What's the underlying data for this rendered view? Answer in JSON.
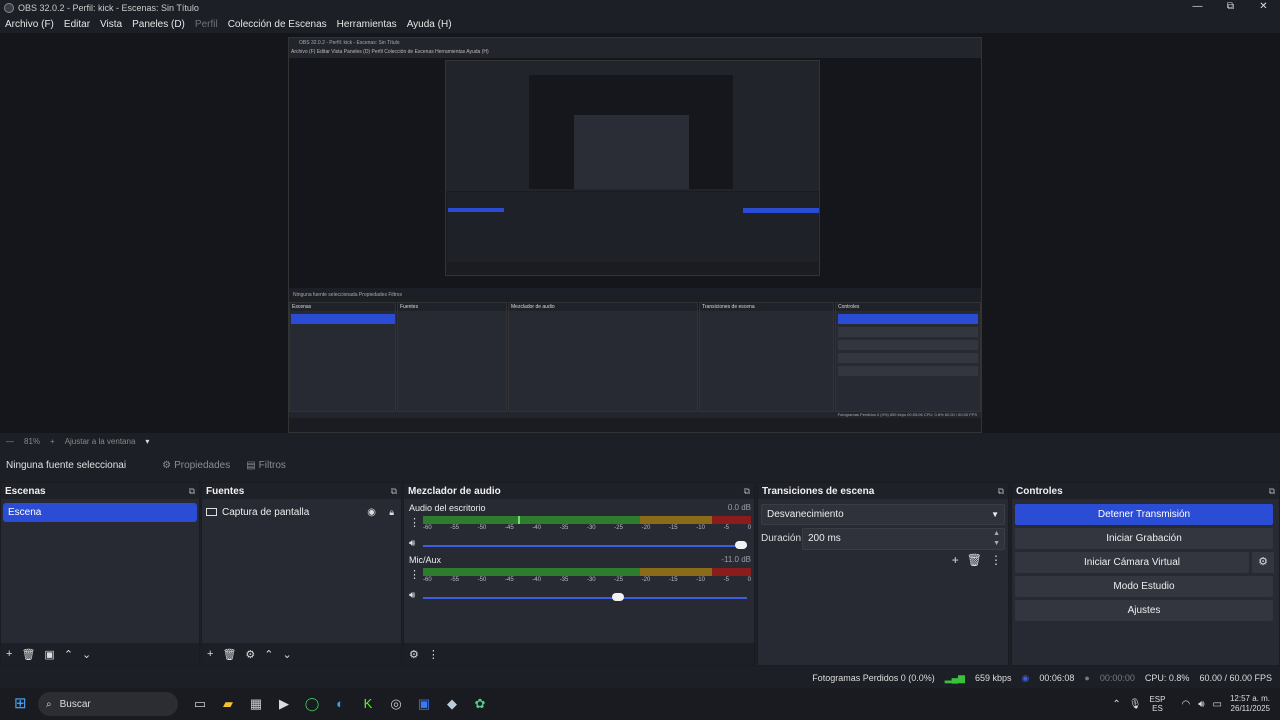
{
  "window": {
    "title": "OBS 32.0.2 - Perfil: kick - Escenas: Sin Título",
    "controls": [
      "—",
      "⧉",
      "✕"
    ]
  },
  "menu": [
    "Archivo (F)",
    "Editar",
    "Vista",
    "Paneles (D)",
    "Perfil",
    "Colección de Escenas",
    "Herramientas",
    "Ayuda (H)"
  ],
  "preview": {
    "nested_title": "OBS 32.0.2 - Perfil: kick - Escenas: Sin Título",
    "nested_menu": "Archivo (F)   Editar   Vista   Paneles (D)   Perfil   Colección de Escenas   Herramientas   Ayuda (H)",
    "nested_source_bar": "Ninguna fuente seleccionada     Propiedades     Filtros",
    "nested_status": "Fotogramas Perdidos 0 (0%)   659 kbps   00:05:06   CPU: 0.8%   60.00 / 60.00 FPS"
  },
  "zoom": {
    "value": "81%",
    "fit_label": "Ajustar a la ventana"
  },
  "source_bar": {
    "none_selected": "Ninguna fuente seleccionai",
    "properties": "Propiedades",
    "filters": "Filtros"
  },
  "scenes": {
    "title": "Escenas",
    "items": [
      "Escena"
    ]
  },
  "sources": {
    "title": "Fuentes",
    "items": [
      "Captura de pantalla"
    ]
  },
  "mixer": {
    "title": "Mezclador de audio",
    "ticks": [
      "-60",
      "-55",
      "-50",
      "-45",
      "-40",
      "-35",
      "-30",
      "-25",
      "-20",
      "-15",
      "-10",
      "-5",
      "0"
    ],
    "channels": [
      {
        "name": "Audio del escritorio",
        "db": "0.0 dB",
        "level": 0.29,
        "volume": 1.0
      },
      {
        "name": "Mic/Aux",
        "db": "-11.0 dB",
        "level": 0.0,
        "volume": 0.62
      }
    ]
  },
  "transitions": {
    "title": "Transiciones de escena",
    "selected": "Desvanecimiento",
    "duration_label": "Duración",
    "duration_value": "200 ms"
  },
  "controls": {
    "title": "Controles",
    "stop_stream": "Detener Transmisión",
    "start_recording": "Iniciar Grabación",
    "start_virtual_cam": "Iniciar Cámara Virtual",
    "studio_mode": "Modo Estudio",
    "settings": "Ajustes"
  },
  "status": {
    "dropped": "Fotogramas Perdidos 0 (0.0%)",
    "bitrate": "659 kbps",
    "stream_time": "00:06:08",
    "rec_time": "00:00:00",
    "cpu": "CPU: 0.8%",
    "fps": "60.00 / 60.00 FPS"
  },
  "taskbar": {
    "search": "Buscar",
    "lang_top": "ESP",
    "lang_bottom": "ES",
    "time": "12:57 a. m.",
    "date": "26/11/2025"
  },
  "colors": {
    "accent": "#2b4dd6",
    "panel": "#272a33",
    "background": "#1d1f26"
  }
}
